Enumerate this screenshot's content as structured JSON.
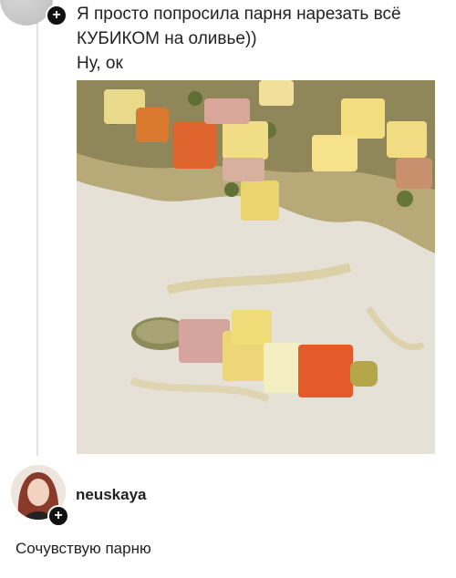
{
  "post": {
    "text": "Я просто попросила парня нарезать всё\nКУБИКОМ на оливье))\nНу, ок"
  },
  "comment": {
    "username": "neuskaya",
    "text": "Сочувствую парню"
  },
  "icons": {
    "follow_badge": "plus-icon",
    "follow_badge_glyph": "+"
  }
}
